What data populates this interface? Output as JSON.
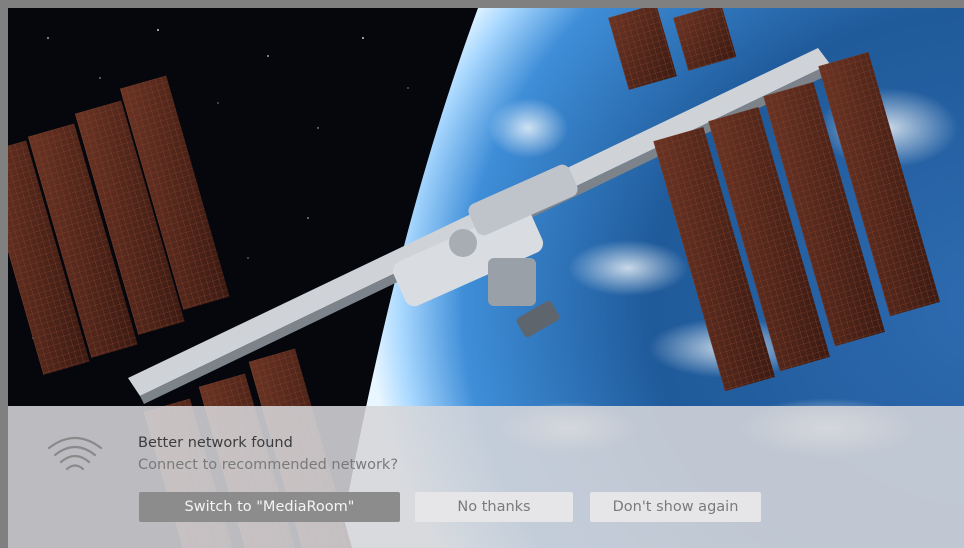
{
  "wallpaper": {
    "subject": "space station orbiting earth",
    "colors": {
      "space": "#05070d",
      "earth_ocean": "#1c4f8a",
      "atmosphere_glow": "#8fc7ff",
      "solar_panel": "#5a2a1c"
    }
  },
  "dialog": {
    "icon": "wifi-icon",
    "title": "Better network found",
    "message": "Connect to recommended network?",
    "buttons": {
      "switch": "Switch to \"MediaRoom\"",
      "no_thanks": "No thanks",
      "dont_show": "Don't show again"
    },
    "colors": {
      "primary_button": "#8c8c8c",
      "secondary_button": "#e6e6e8",
      "panel": "#d6d6da"
    }
  }
}
